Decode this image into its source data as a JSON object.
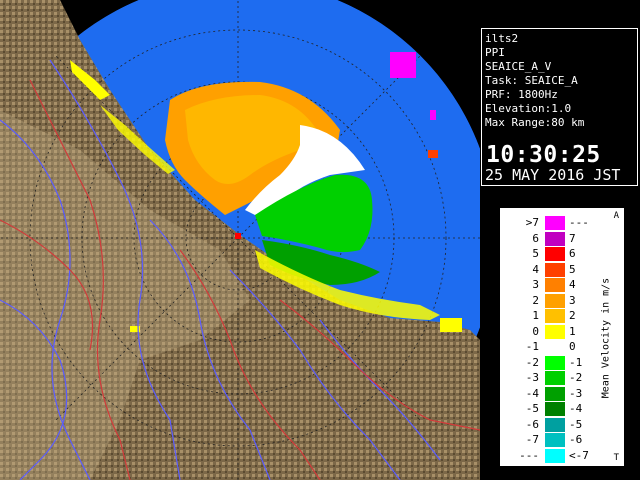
{
  "info": {
    "lines": [
      "ilts2",
      "PPI",
      "SEAICE_A_V",
      "Task: SEAICE_A",
      "PRF: 1800Hz",
      "Elevation:1.0",
      "Max Range:80 km"
    ],
    "time": "10:30:25",
    "date": "25 MAY 2016 JST"
  },
  "legend": {
    "title": "Mean Velocity in m/s",
    "corner_top": "A",
    "corner_bottom": "T",
    "rows": [
      {
        "left": ">7",
        "right": "---",
        "color": "#ff00ff"
      },
      {
        "left": "6",
        "right": "7",
        "color": "#c000c0"
      },
      {
        "left": "5",
        "right": "6",
        "color": "#ff0000"
      },
      {
        "left": "4",
        "right": "5",
        "color": "#ff4000"
      },
      {
        "left": "3",
        "right": "4",
        "color": "#ff8000"
      },
      {
        "left": "2",
        "right": "3",
        "color": "#ffa000"
      },
      {
        "left": "1",
        "right": "2",
        "color": "#ffc000"
      },
      {
        "left": "0",
        "right": "1",
        "color": "#ffff00"
      },
      {
        "left": "-1",
        "right": "0",
        "color": "#ffffff"
      },
      {
        "left": "-2",
        "right": "-1",
        "color": "#00ff00"
      },
      {
        "left": "-3",
        "right": "-2",
        "color": "#00d000"
      },
      {
        "left": "-4",
        "right": "-3",
        "color": "#00a000"
      },
      {
        "left": "-5",
        "right": "-4",
        "color": "#008000"
      },
      {
        "left": "-6",
        "right": "-5",
        "color": "#00a0a0"
      },
      {
        "left": "-7",
        "right": "-6",
        "color": "#00c0c0"
      },
      {
        "left": "---",
        "right": "<-7",
        "color": "#00ffff"
      }
    ]
  },
  "colors": {
    "sea": "#1e6cf0",
    "land": "#7a6646",
    "terrain_light": "#b9a57b",
    "rivers": "#5a5cff",
    "boundaries": "#d23a3a"
  }
}
